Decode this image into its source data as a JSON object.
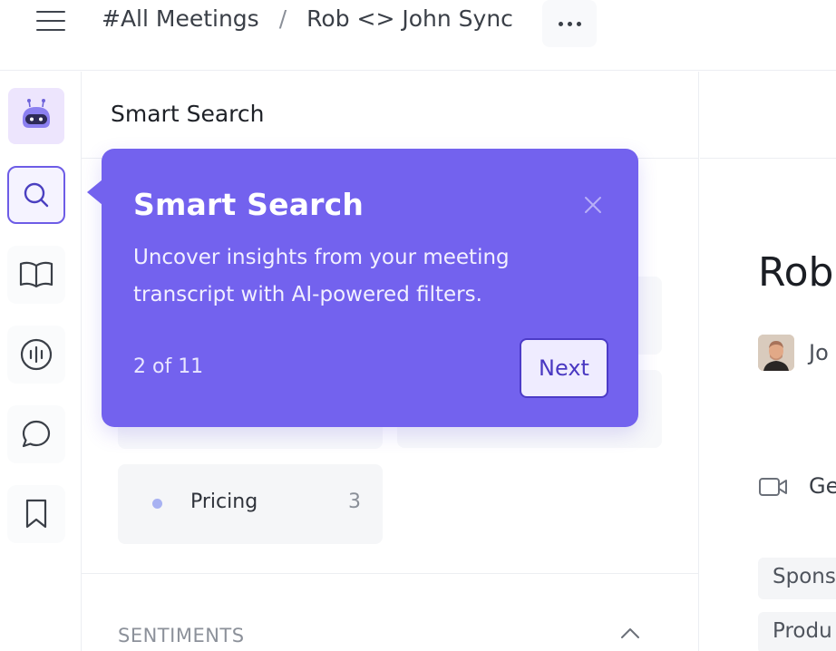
{
  "header": {
    "menu_icon": "hamburger-icon",
    "breadcrumb": [
      "#All Meetings",
      "Rob <> John Sync"
    ],
    "separator": "/",
    "more_icon": "more-horizontal-icon"
  },
  "rail": {
    "items": [
      {
        "name": "assistant-bot",
        "icon": "robot-icon"
      },
      {
        "name": "smart-search",
        "icon": "search-icon",
        "active": true
      },
      {
        "name": "notes",
        "icon": "book-open-icon"
      },
      {
        "name": "audio",
        "icon": "audio-wave-icon"
      },
      {
        "name": "comments",
        "icon": "chat-bubble-icon"
      },
      {
        "name": "bookmarks",
        "icon": "bookmark-icon"
      }
    ]
  },
  "panel": {
    "title": "Smart Search",
    "topics": [
      {
        "label": "Pricing",
        "count": "3",
        "dot_color": "#a8b2f2"
      }
    ],
    "section_heading": "SENTIMENTS"
  },
  "meeting": {
    "title": "Rob",
    "participant": "Jo",
    "call_label": "Ge",
    "tags": [
      "Spons",
      "Produ"
    ]
  },
  "tooltip": {
    "title": "Smart Search",
    "body": "Uncover insights from your meeting transcript with AI-powered filters.",
    "step": "2 of 11",
    "next_label": "Next",
    "background": "#7362ee"
  },
  "colors": {
    "accent": "#6d5ce6",
    "tooltip": "#7362ee",
    "border": "#eceef2"
  }
}
